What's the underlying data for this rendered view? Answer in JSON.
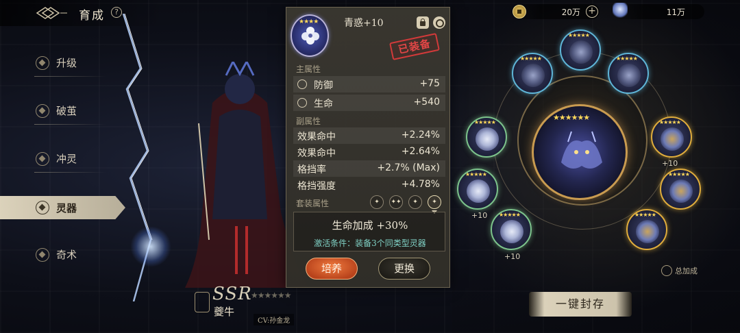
{
  "header": {
    "title": "育成",
    "help": "?"
  },
  "nav": {
    "items": [
      {
        "label": "升级"
      },
      {
        "label": "破茧"
      },
      {
        "label": "冲灵"
      },
      {
        "label": "灵器"
      },
      {
        "label": "奇术"
      }
    ],
    "active": "灵器"
  },
  "character": {
    "rarity": "SSR",
    "stars": "★★★★★★",
    "name": "夔牛",
    "cv": "CV:孙金龙"
  },
  "item": {
    "name": "青惑+10",
    "stars": "★★★★",
    "equipped_stamp": "已装备",
    "main_label": "主属性",
    "main_stats": [
      {
        "name": "防御",
        "value": "+75"
      },
      {
        "name": "生命",
        "value": "+540"
      }
    ],
    "sub_label": "副属性",
    "sub_stats": [
      {
        "name": "效果命中",
        "value": "+2.24%"
      },
      {
        "name": "效果命中",
        "value": "+2.64%"
      },
      {
        "name": "格挡率",
        "value": "+2.7% (Max)"
      },
      {
        "name": "格挡强度",
        "value": "+4.78%"
      }
    ],
    "set_label": "套装属性",
    "set_effect": "生命加成 +30%",
    "set_condition": "激活条件：装备3个同类型灵器",
    "buttons": {
      "upgrade": "培养",
      "replace": "更换"
    }
  },
  "currency": [
    {
      "value": "20万"
    },
    {
      "value": "11万"
    }
  ],
  "wheel": {
    "slot_levels": [
      "+10",
      "+10",
      "+10"
    ],
    "total_bonus": "总加成",
    "seal_button": "一键封存"
  },
  "colors": {
    "accent_gold": "#c99b50",
    "stamp_red": "#d23a3a",
    "condition_teal": "#7fd0c4",
    "upgrade_orange": "#e0642c"
  },
  "icons": [
    "logo-icon",
    "help-icon",
    "lock-icon",
    "settings-wheel-icon",
    "coin-icon",
    "spirit-icon",
    "plus-icon",
    "defense-icon",
    "health-icon"
  ]
}
